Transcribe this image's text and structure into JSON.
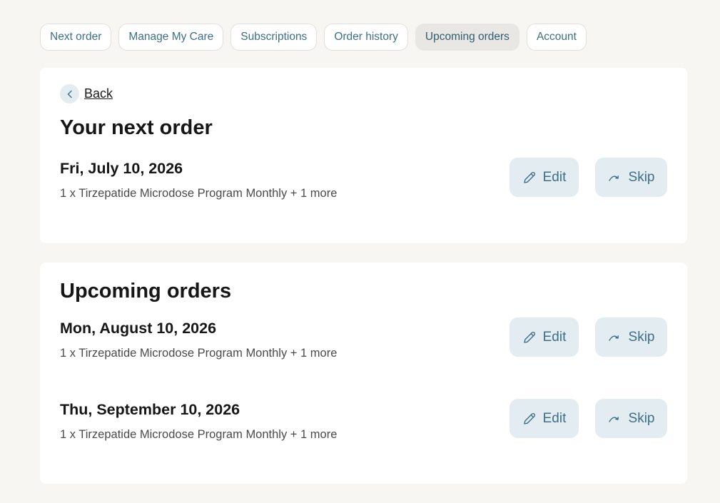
{
  "tabs": [
    {
      "label": "Next order"
    },
    {
      "label": "Manage My Care"
    },
    {
      "label": "Subscriptions"
    },
    {
      "label": "Order history"
    },
    {
      "label": "Upcoming orders",
      "active": true
    },
    {
      "label": "Account"
    }
  ],
  "next_order": {
    "back_label": "Back",
    "title": "Your next order",
    "order": {
      "date": "Fri, July 10, 2026",
      "description": "1 x Tirzepatide Microdose Program Monthly + 1 more",
      "edit_label": "Edit",
      "skip_label": "Skip"
    }
  },
  "upcoming": {
    "title": "Upcoming orders",
    "orders": [
      {
        "date": "Mon, August 10, 2026",
        "description": "1 x Tirzepatide Microdose Program Monthly + 1 more",
        "edit_label": "Edit",
        "skip_label": "Skip"
      },
      {
        "date": "Thu, September 10, 2026",
        "description": "1 x Tirzepatide Microdose Program Monthly + 1 more",
        "edit_label": "Edit",
        "skip_label": "Skip"
      }
    ]
  },
  "colors": {
    "background": "#f8f6f2",
    "accent": "#3d6f86",
    "button_bg": "#e3ecf0",
    "active_tab_bg": "#e8e7e4"
  },
  "icons": {
    "back": "chevron-left-icon",
    "edit": "pencil-icon",
    "skip": "skip-arc-icon"
  }
}
